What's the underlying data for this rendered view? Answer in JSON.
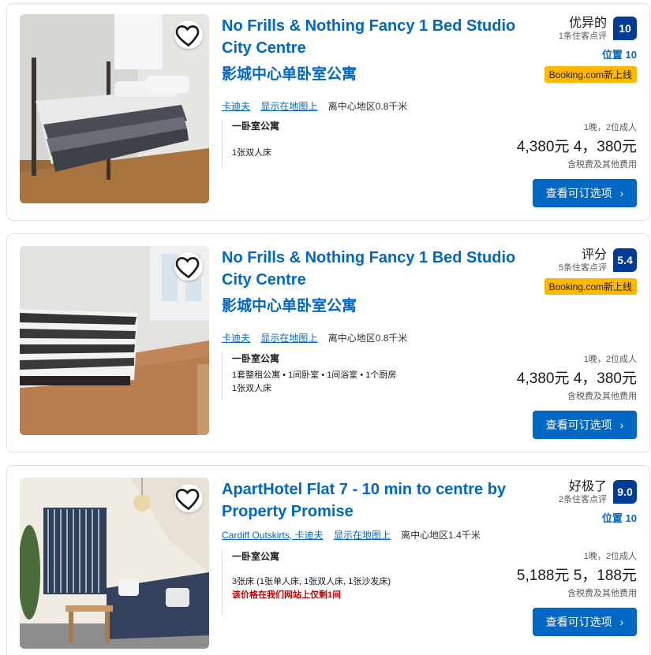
{
  "listings": [
    {
      "title": "No Frills & Nothing Fancy 1 Bed Studio City Centre",
      "title_cn": "影城中心单卧室公寓",
      "location_links": [
        "卡迪夫",
        "显示在地图上"
      ],
      "distance": "离中心地区0.8千米",
      "unit_name": "一卧室公寓",
      "unit_features": "",
      "bed_info": "1张双人床",
      "availability_warning": "",
      "rating_word": "优异的",
      "review_count": "1条住客点评",
      "score": "10",
      "location_score": "位置 10",
      "new_badge": "Booking.com新上线",
      "stay": "1晚，2位成人",
      "price": "4,380元 4，380元",
      "tax_note": "含税费及其他费用",
      "cta": "查看可订选项"
    },
    {
      "title": "No Frills & Nothing Fancy 1 Bed Studio City Centre",
      "title_cn": "影城中心单卧室公寓",
      "location_links": [
        "卡迪夫",
        "显示在地图上"
      ],
      "distance": "离中心地区0.8千米",
      "unit_name": "一卧室公寓",
      "unit_features": "1套整租公寓 • 1间卧室 • 1间浴室 • 1个厨房",
      "bed_info": "1张双人床",
      "availability_warning": "",
      "rating_word": "评分",
      "review_count": "5条住客点评",
      "score": "5.4",
      "location_score": "",
      "new_badge": "Booking.com新上线",
      "stay": "1晚，2位成人",
      "price": "4,380元 4，380元",
      "tax_note": "含税费及其他费用",
      "cta": "查看可订选项"
    },
    {
      "title": "ApartHotel Flat 7 - 10 min to centre by Property Promise",
      "title_cn": "",
      "location_links": [
        "Cardiff Outskirts, 卡迪夫",
        "显示在地图上"
      ],
      "distance": "离中心地区1.4千米",
      "unit_name": "一卧室公寓",
      "unit_features": "",
      "bed_info": "3张床 (1张单人床, 1张双人床, 1张沙发床)",
      "availability_warning": "该价格在我们网站上仅剩1间",
      "rating_word": "好极了",
      "review_count": "2条住客点评",
      "score": "9.0",
      "location_score": "位置 10",
      "new_badge": "",
      "stay": "1晚，2位成人",
      "price": "5,188元 5，188元",
      "tax_note": "含税费及其他费用",
      "cta": "查看可订选项"
    }
  ],
  "colors": {
    "link_blue": "#0067c2",
    "score_bg": "#003b95",
    "badge_yellow": "#ffb700",
    "warning_red": "#c00000"
  },
  "icons": {
    "save": "heart-icon",
    "cta": "chevron-right-icon"
  }
}
